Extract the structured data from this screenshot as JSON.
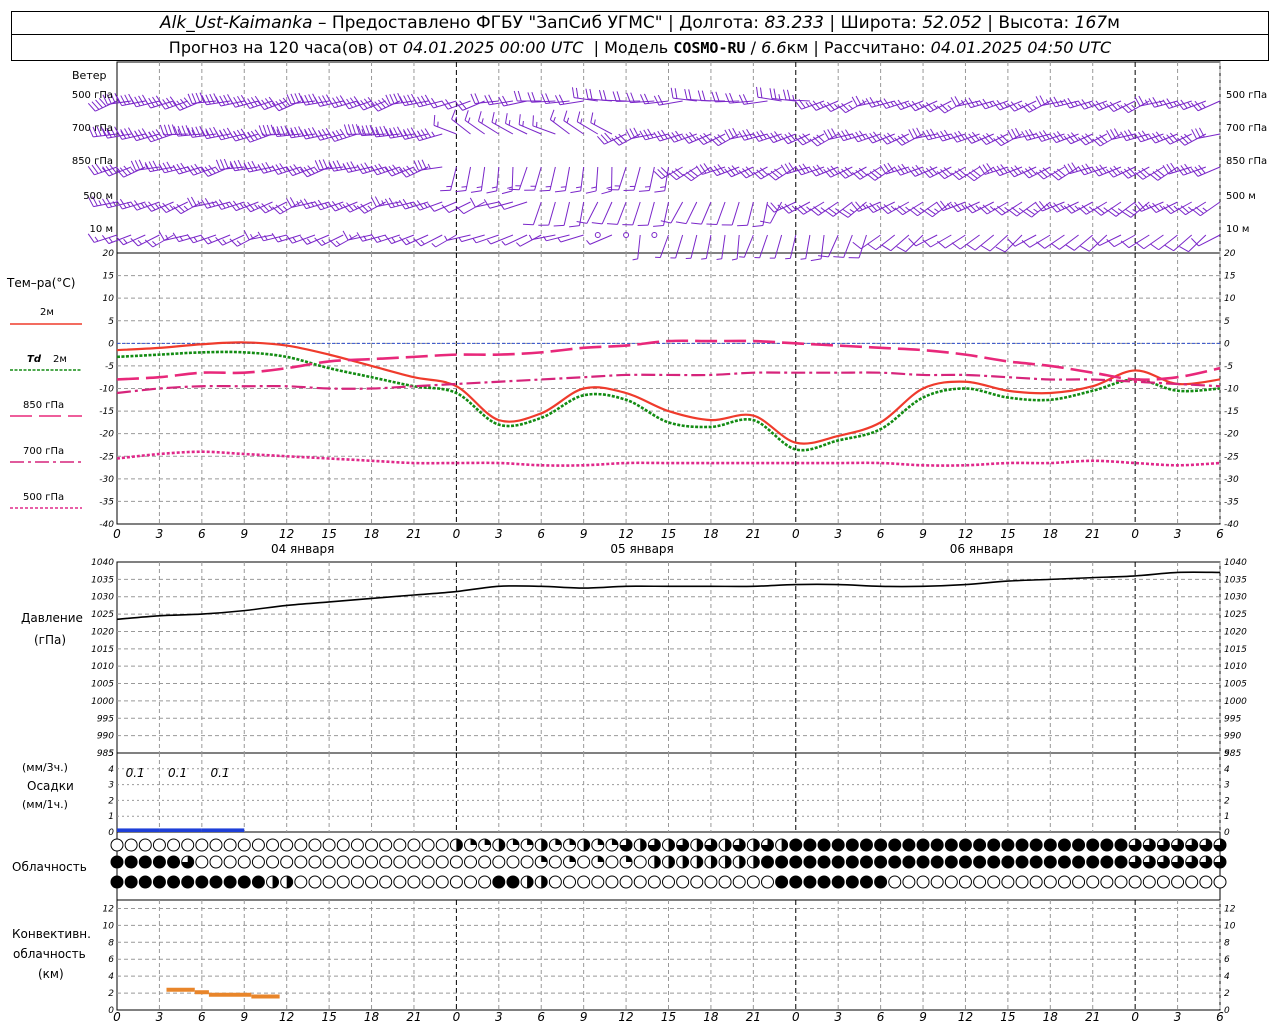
{
  "header": {
    "station": "Alk_Ust-Kaimanka",
    "dash": " – ",
    "provider": "Предоставлено ФГБУ \"ЗапСиб УГМС\"",
    "lon_label": "Долгота:",
    "lon": "83.233",
    "lat_label": "Широта:",
    "lat": "52.052",
    "alt_label": "Высота:",
    "alt": "167",
    "alt_unit": "м",
    "forecast_label": "Прогноз на 120 часа(ов)  от",
    "forecast_time": "04.01.2025 00:00 UTC",
    "model_label": "Модель",
    "model": "COSMO-RU",
    "resolution": "6.6",
    "res_unit": "км",
    "calc_label": "Рассчитано:",
    "calc_time": "04.01.2025 04:50 UTC"
  },
  "wind_panel": {
    "title": "Ветер",
    "levels": [
      "500 гПа",
      "700 гПа",
      "850 гПа",
      "500 м",
      "10 м"
    ]
  },
  "colors": {
    "t2m": "#ef3b2c",
    "td2m": "#138c13",
    "t850": "#e8287a",
    "t700": "#d6247b",
    "t500": "#e0288a",
    "zero_line": "#3050d0",
    "wind": "#7a26c9",
    "precip": "#1e3fd8",
    "convective": "#e8852a"
  },
  "x_axis": {
    "ticks": [
      "0",
      "3",
      "6",
      "9",
      "12",
      "15",
      "18",
      "21",
      "0",
      "3",
      "6",
      "9",
      "12",
      "15",
      "18",
      "21",
      "0",
      "3",
      "6",
      "9",
      "12",
      "15",
      "18",
      "21",
      "0",
      "3",
      "6"
    ],
    "days": [
      "04 января",
      "05 января",
      "06 января"
    ]
  },
  "panel_labels": {
    "temp_title": "Тем–ра(°C)",
    "t2m": "2м",
    "td_prefix": "Td",
    "td2m": "2м",
    "t850": "850 гПа",
    "t700": "700 гПа",
    "t500": "500 гПа",
    "pressure_1": "Давление",
    "pressure_2": "(гПа)",
    "precip_1": "(мм/3ч.)",
    "precip_2": "Осадки",
    "precip_3": "(мм/1ч.)",
    "cloud": "Облачность",
    "conv_1": "Конвективн.",
    "conv_2": "облачность",
    "conv_3": "(км)"
  },
  "chart_data": [
    {
      "type": "line",
      "title": "Тем–ра(°C)",
      "x_hours": [
        0,
        3,
        6,
        9,
        12,
        15,
        18,
        21,
        24,
        27,
        30,
        33,
        36,
        39,
        42,
        45,
        48,
        51,
        54,
        57,
        60,
        63,
        66,
        69,
        72,
        75,
        78
      ],
      "ylim": [
        -40,
        20
      ],
      "yticks": [
        20,
        15,
        10,
        5,
        0,
        -5,
        -10,
        -15,
        -20,
        -25,
        -30,
        -35,
        -40
      ],
      "series": [
        {
          "name": "2м",
          "values": [
            -1.5,
            -1,
            -0.2,
            0.2,
            -0.5,
            -2.5,
            -5,
            -7.5,
            -9.5,
            -17,
            -15.5,
            -10,
            -11,
            -15,
            -17,
            -16,
            -22,
            -20.5,
            -17.5,
            -10,
            -8.5,
            -10.5,
            -11,
            -9.5,
            -6,
            -9,
            -8
          ]
        },
        {
          "name": "Td 2м",
          "values": [
            -3,
            -2.5,
            -2,
            -2,
            -3,
            -5.5,
            -7.5,
            -9.5,
            -11,
            -18,
            -16.5,
            -11.5,
            -12.5,
            -17.5,
            -18.5,
            -17,
            -23.5,
            -21.5,
            -19,
            -12,
            -10,
            -12,
            -12.5,
            -10.5,
            -8,
            -10.5,
            -10
          ]
        },
        {
          "name": "850 гПа",
          "values": [
            -8,
            -7.5,
            -6.5,
            -6.5,
            -5.5,
            -4,
            -3.5,
            -3,
            -2.5,
            -2.5,
            -2,
            -1,
            -0.5,
            0.5,
            0.5,
            0.5,
            0,
            -0.5,
            -1,
            -1.5,
            -2.5,
            -4,
            -5,
            -6.5,
            -8,
            -7.5,
            -5.5
          ]
        },
        {
          "name": "700 гПа",
          "values": [
            -11,
            -10,
            -9.5,
            -9.5,
            -9.5,
            -10,
            -10,
            -9.5,
            -9,
            -8.5,
            -8,
            -7.5,
            -7,
            -7,
            -7,
            -6.5,
            -6.5,
            -6.5,
            -6.5,
            -7,
            -7,
            -7.5,
            -8,
            -8,
            -8.5,
            -9,
            -9.5
          ]
        },
        {
          "name": "500 гПа",
          "values": [
            -25.5,
            -24.5,
            -24,
            -24.5,
            -25,
            -25.5,
            -26,
            -26.5,
            -26.5,
            -26.5,
            -27,
            -27,
            -26.5,
            -26.5,
            -26.5,
            -26.5,
            -26.5,
            -26.5,
            -26.5,
            -27,
            -27,
            -26.5,
            -26.5,
            -26,
            -26.5,
            -27,
            -26.5
          ]
        }
      ]
    },
    {
      "type": "line",
      "title": "Давление (гПа)",
      "x_hours": [
        0,
        3,
        6,
        9,
        12,
        15,
        18,
        21,
        24,
        27,
        30,
        33,
        36,
        39,
        42,
        45,
        48,
        51,
        54,
        57,
        60,
        63,
        66,
        69,
        72,
        75,
        78
      ],
      "ylim": [
        985,
        1040
      ],
      "yticks": [
        1040,
        1035,
        1030,
        1025,
        1020,
        1015,
        1010,
        1005,
        1000,
        995,
        990,
        985
      ],
      "series": [
        {
          "name": "Давление",
          "values": [
            1023.5,
            1024.5,
            1025,
            1026,
            1027.5,
            1028.5,
            1029.5,
            1030.5,
            1031.5,
            1033,
            1033,
            1032.5,
            1033,
            1033,
            1033,
            1033,
            1033.5,
            1033.5,
            1033,
            1033,
            1033.5,
            1034.5,
            1035,
            1035.5,
            1036,
            1037,
            1037
          ]
        }
      ]
    },
    {
      "type": "bar",
      "title": "Осадки",
      "ylim": [
        0,
        5
      ],
      "yticks": [
        5,
        4,
        3,
        2,
        1,
        0
      ],
      "x_hours": [
        1,
        4,
        7
      ],
      "values": [
        0.1,
        0.1,
        0.1
      ],
      "labels": [
        "0.1",
        "0.1",
        "0.1"
      ]
    },
    {
      "type": "line",
      "title": "Конвективн. облачность (км)",
      "ylim": [
        0,
        13
      ],
      "yticks": [
        12,
        10,
        8,
        6,
        4,
        2,
        0
      ],
      "segments": [
        {
          "x": [
            3.5,
            5.5
          ],
          "value": 2.4
        },
        {
          "x": [
            5.5,
            6.5
          ],
          "value": 2.1
        },
        {
          "x": [
            6.5,
            9.5
          ],
          "value": 1.8
        },
        {
          "x": [
            9.5,
            11.5
          ],
          "value": 1.6
        }
      ]
    }
  ]
}
